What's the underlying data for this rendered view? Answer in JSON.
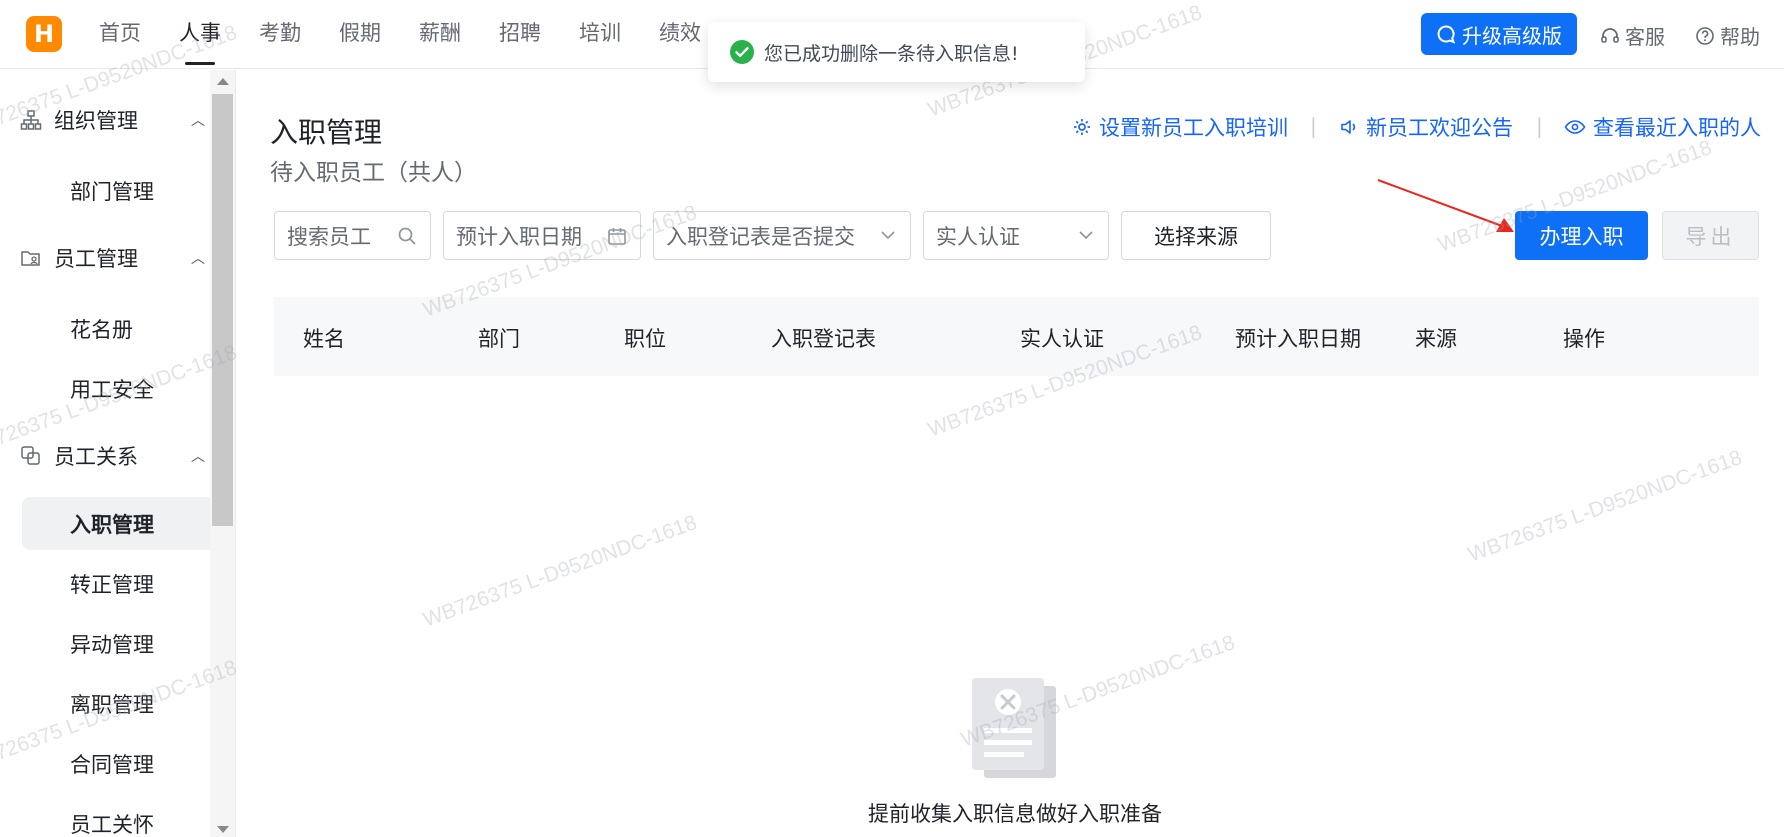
{
  "logo": {
    "letter": "H"
  },
  "nav": {
    "items": [
      "首页",
      "人事",
      "考勤",
      "假期",
      "薪酬",
      "招聘",
      "培训",
      "绩效"
    ],
    "active_index": 1
  },
  "topbar": {
    "upgrade_label": "升级高级版",
    "service_label": "客服",
    "help_label": "帮助"
  },
  "toast": {
    "message": "您已成功删除一条待入职信息!"
  },
  "sidebar": {
    "groups": [
      {
        "label": "组织管理",
        "icon": "org-chart-icon"
      },
      {
        "label": "员工管理",
        "icon": "folder-user-icon"
      },
      {
        "label": "员工关系",
        "icon": "relation-icon"
      }
    ],
    "items": [
      "部门管理",
      "花名册",
      "用工安全",
      "入职管理",
      "转正管理",
      "异动管理",
      "离职管理",
      "合同管理",
      "员工关怀"
    ],
    "active_item": "入职管理"
  },
  "page": {
    "title": "入职管理",
    "subtitle": "待入职员工（共人）"
  },
  "quick_links": [
    "设置新员工入职培训",
    "新员工欢迎公告",
    "查看最近入职的人"
  ],
  "filters": {
    "search_placeholder": "搜索员工",
    "date_placeholder": "预计入职日期",
    "form_status": "入职登记表是否提交",
    "auth_status": "实人认证",
    "source": "选择来源"
  },
  "actions": {
    "onboard": "办理入职",
    "export": "导出"
  },
  "table": {
    "columns": [
      "姓名",
      "部门",
      "职位",
      "入职登记表",
      "实人认证",
      "预计入职日期",
      "来源",
      "操作"
    ]
  },
  "empty": {
    "text": "提前收集入职信息做好入职准备"
  },
  "watermark": {
    "text": "WB726375 L-D9520NDC-1618"
  },
  "colors": {
    "primary": "#0e6ff7",
    "link": "#1664ff",
    "success": "#2ab14b",
    "logo": "#ff8a00",
    "annotation": "#e8271f"
  }
}
